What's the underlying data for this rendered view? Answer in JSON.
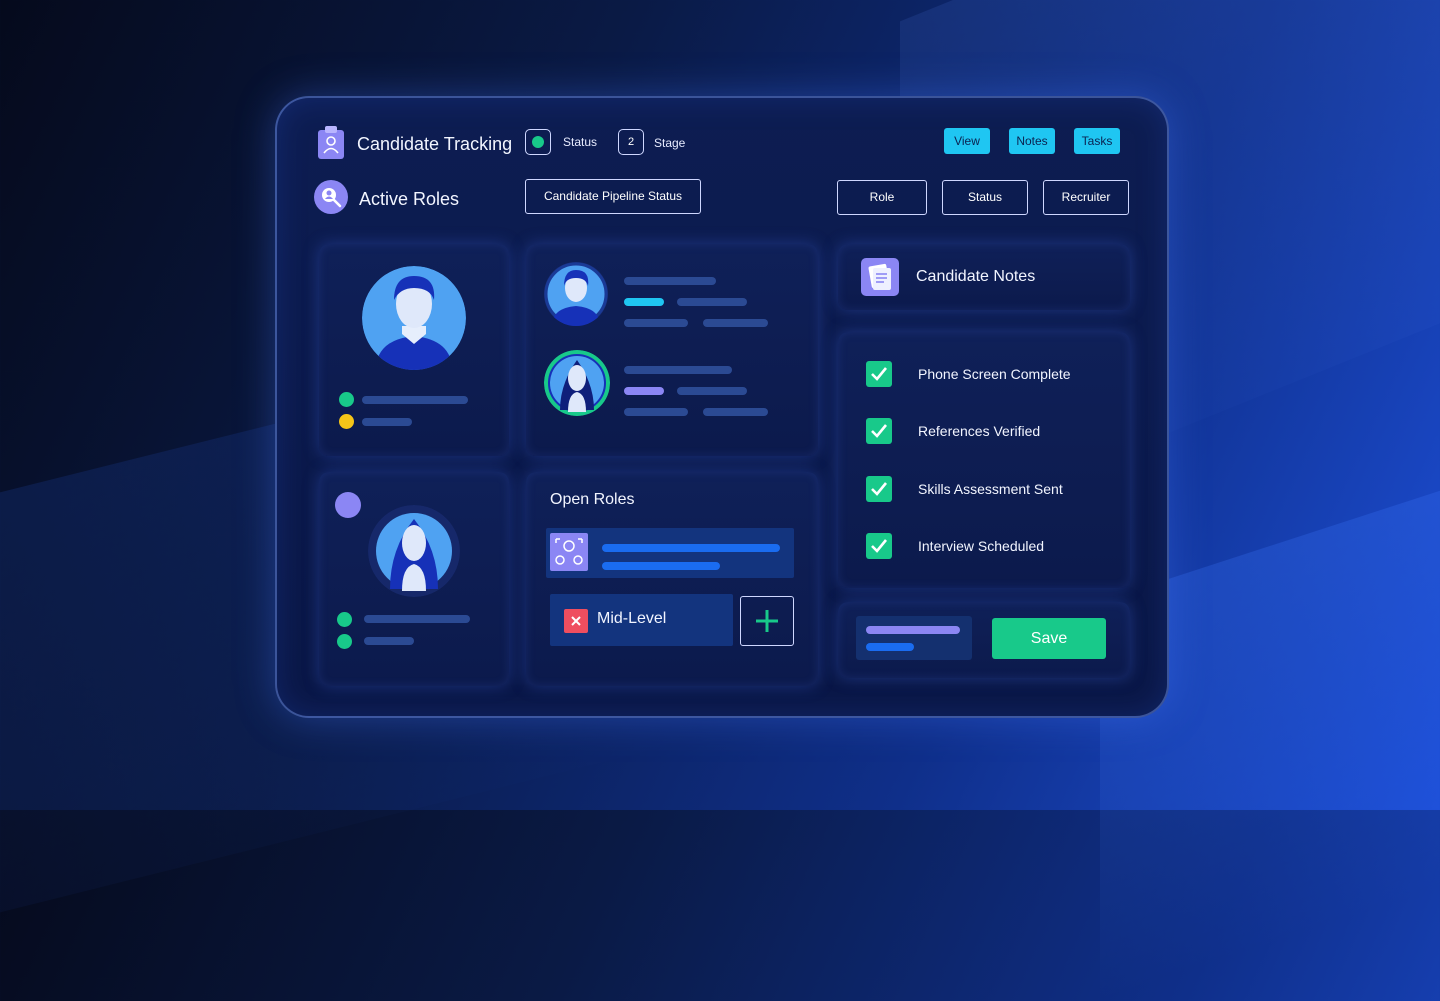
{
  "header": {
    "app_title": "Candidate Tracking",
    "status_label": "Status",
    "stage_value": "2",
    "stage_label": "Stage",
    "actions": [
      "View",
      "Notes",
      "Tasks"
    ],
    "section_title": "Active Roles",
    "pipeline_button": "Candidate Pipeline Status",
    "filters": [
      "Role",
      "Status",
      "Recruiter"
    ]
  },
  "notes": {
    "title": "Candidate Notes",
    "tasks": [
      {
        "label": "Phone Screen Complete",
        "checked": true
      },
      {
        "label": "References Verified",
        "checked": true
      },
      {
        "label": "Skills Assessment Sent",
        "checked": true
      },
      {
        "label": "Interview Scheduled",
        "checked": true
      }
    ],
    "save_label": "Save"
  },
  "open_roles": {
    "title": "Open Roles",
    "level_label": "Mid-Level",
    "add_icon": "plus-icon",
    "remove_icon": "close-icon"
  },
  "colors": {
    "accent_cyan": "#1fc6f2",
    "success_green": "#18c98a",
    "violet": "#8b86f4",
    "warning_yellow": "#f5c518",
    "danger_red": "#ef4e5f",
    "panel_bg": "#0d1d52"
  }
}
